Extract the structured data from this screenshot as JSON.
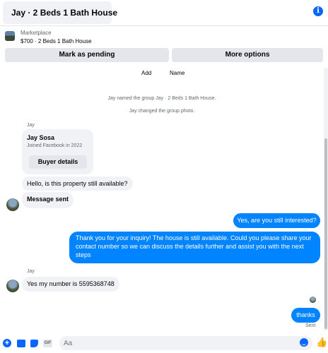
{
  "header": {
    "title": "Jay · 2 Beds 1 Bath House",
    "info_glyph": "i"
  },
  "marketplace": {
    "label": "Marketplace",
    "listing": "$700 · 2 Beds 1 Bath House",
    "mark_pending": "Mark as pending",
    "more_options": "More options"
  },
  "top_actions": {
    "add": "Add",
    "name": "Name"
  },
  "system": {
    "named": "Jay named the group Jay · 2 Beds 1 Bath House.",
    "photo": "Jay changed the group photo."
  },
  "thread": {
    "sender_1": "Jay",
    "card_name": "Jay Sosa",
    "card_sub": "Joined Facebook in 2022",
    "card_button": "Buyer details",
    "msg_1": "Hello, is this property still available?",
    "msg_2": "Message sent",
    "out_1": "Yes, are you still interested?",
    "out_2": "Thank you for your inquiry! The house is still available. Could you please share your contact number so we can discuss the details further and assist you with the next steps",
    "sender_2": "Jay",
    "msg_3": "Yes my number is 5595368748",
    "out_3": "thanks",
    "status": "Sent"
  },
  "composer": {
    "placeholder": "Aa",
    "plus_glyph": "+",
    "gif_label": "GIF",
    "like_glyph": "👍"
  },
  "colors": {
    "accent": "#0866ff",
    "outgoing_bubble": "#0084ff",
    "incoming_bubble": "#f0f2f5"
  }
}
